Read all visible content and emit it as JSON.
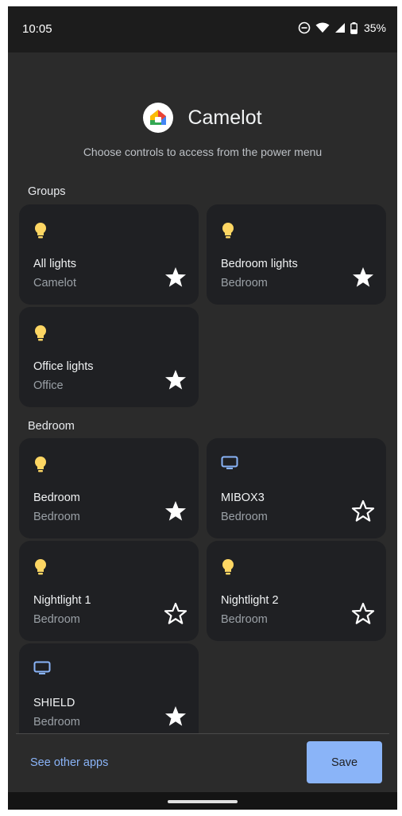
{
  "status": {
    "time": "10:05",
    "battery": "35%"
  },
  "app": {
    "title": "Camelot",
    "subtitle": "Choose controls to access from the power menu"
  },
  "sections": [
    {
      "label": "Groups"
    },
    {
      "label": "Bedroom"
    }
  ],
  "groups": [
    {
      "name": "All lights",
      "room": "Camelot",
      "icon": "lightbulb-icon",
      "favorite": true
    },
    {
      "name": "Bedroom lights",
      "room": "Bedroom",
      "icon": "lightbulb-icon",
      "favorite": true
    },
    {
      "name": "Office lights",
      "room": "Office",
      "icon": "lightbulb-icon",
      "favorite": true
    }
  ],
  "bedroom": [
    {
      "name": "Bedroom",
      "room": "Bedroom",
      "icon": "lightbulb-icon",
      "favorite": true
    },
    {
      "name": "MIBOX3",
      "room": "Bedroom",
      "icon": "tv-icon",
      "favorite": false
    },
    {
      "name": "Nightlight 1",
      "room": "Bedroom",
      "icon": "lightbulb-icon",
      "favorite": false
    },
    {
      "name": "Nightlight 2",
      "room": "Bedroom",
      "icon": "lightbulb-icon",
      "favorite": false
    },
    {
      "name": "SHIELD",
      "room": "Bedroom",
      "icon": "tv-icon",
      "favorite": true
    }
  ],
  "footer": {
    "see_other": "See other apps",
    "save": "Save"
  },
  "colors": {
    "background": "#2b2b2b",
    "card": "#1f2023",
    "accent": "#8ab4f8",
    "bulb": "#fdd663"
  }
}
